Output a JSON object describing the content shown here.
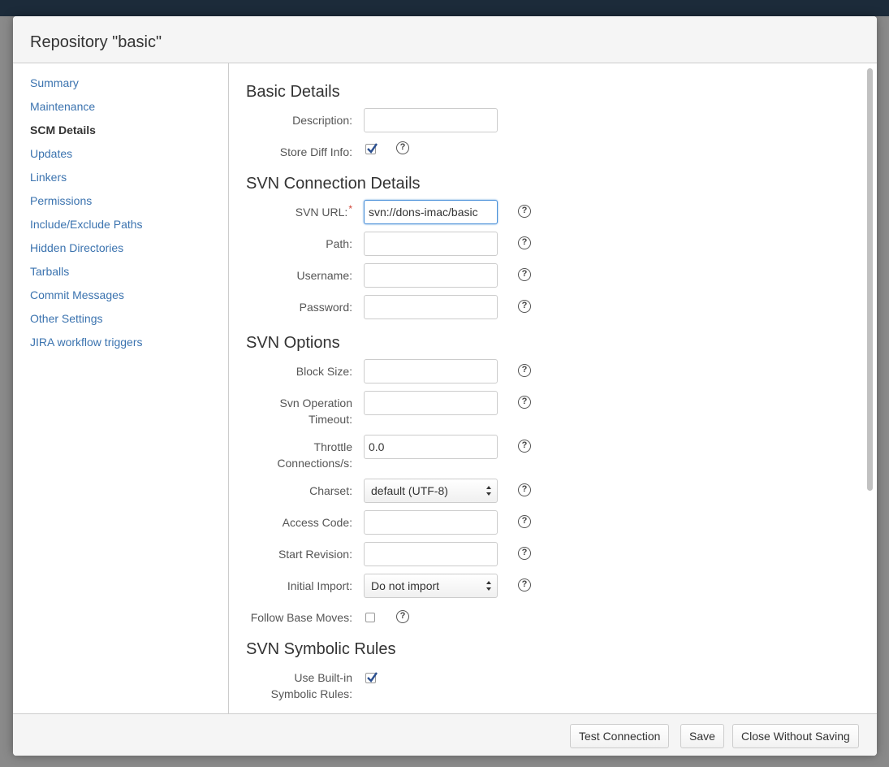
{
  "dialog": {
    "title": "Repository \"basic\""
  },
  "nav": {
    "items": [
      {
        "label": "Summary"
      },
      {
        "label": "Maintenance"
      },
      {
        "label": "SCM Details"
      },
      {
        "label": "Updates"
      },
      {
        "label": "Linkers"
      },
      {
        "label": "Permissions"
      },
      {
        "label": "Include/Exclude Paths"
      },
      {
        "label": "Hidden Directories"
      },
      {
        "label": "Tarballs"
      },
      {
        "label": "Commit Messages"
      },
      {
        "label": "Other Settings"
      },
      {
        "label": "JIRA workflow triggers"
      }
    ],
    "active": "SCM Details"
  },
  "basic_details": {
    "title": "Basic Details",
    "description_label": "Description:",
    "description_value": "",
    "store_diff_label": "Store Diff Info:",
    "store_diff_checked": true
  },
  "svn_connection": {
    "title": "SVN Connection Details",
    "url_label": "SVN URL:",
    "url_required_mark": "*",
    "url_value": "svn://dons-imac/basic",
    "path_label": "Path:",
    "path_value": "",
    "username_label": "Username:",
    "username_value": "",
    "password_label": "Password:",
    "password_value": ""
  },
  "svn_options": {
    "title": "SVN Options",
    "block_size_label": "Block Size:",
    "block_size_value": "",
    "timeout_label_1": "Svn Operation",
    "timeout_label_2": "Timeout:",
    "timeout_value": "",
    "throttle_label_1": "Throttle",
    "throttle_label_2": "Connections/s:",
    "throttle_value": "0.0",
    "charset_label": "Charset:",
    "charset_value": "default (UTF-8)",
    "access_code_label": "Access Code:",
    "access_code_value": "",
    "start_revision_label": "Start Revision:",
    "start_revision_value": "",
    "initial_import_label": "Initial Import:",
    "initial_import_value": "Do not import",
    "follow_base_label": "Follow Base Moves:",
    "follow_base_checked": false
  },
  "svn_symbolic": {
    "title": "SVN Symbolic Rules",
    "builtin_label_1": "Use Built-in",
    "builtin_label_2": "Symbolic Rules:",
    "builtin_checked": true
  },
  "help_glyph": "?",
  "footer": {
    "test_label": "Test Connection",
    "save_label": "Save",
    "close_label": "Close Without Saving"
  }
}
